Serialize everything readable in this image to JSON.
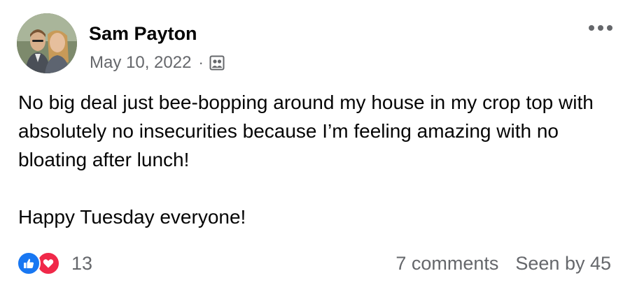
{
  "post": {
    "author": "Sam Payton",
    "date": "May 10, 2022",
    "separator": "·",
    "audience_icon": "group-audience-icon",
    "more_icon": "more-options-icon",
    "body_paragraphs": [
      "No big deal just bee-bopping around my house in my crop top with absolutely no insecurities because I’m feeling amazing with no bloating after lunch!",
      "Happy Tuesday everyone!"
    ]
  },
  "reactions": {
    "icons": [
      "like-reaction-icon",
      "love-reaction-icon"
    ],
    "count": "13",
    "like_color": "#1877f2",
    "love_color": "#f02849"
  },
  "stats": {
    "comments": "7 comments",
    "seen_by": "Seen by 45"
  },
  "colors": {
    "text": "#050505",
    "secondary_text": "#65676b"
  }
}
